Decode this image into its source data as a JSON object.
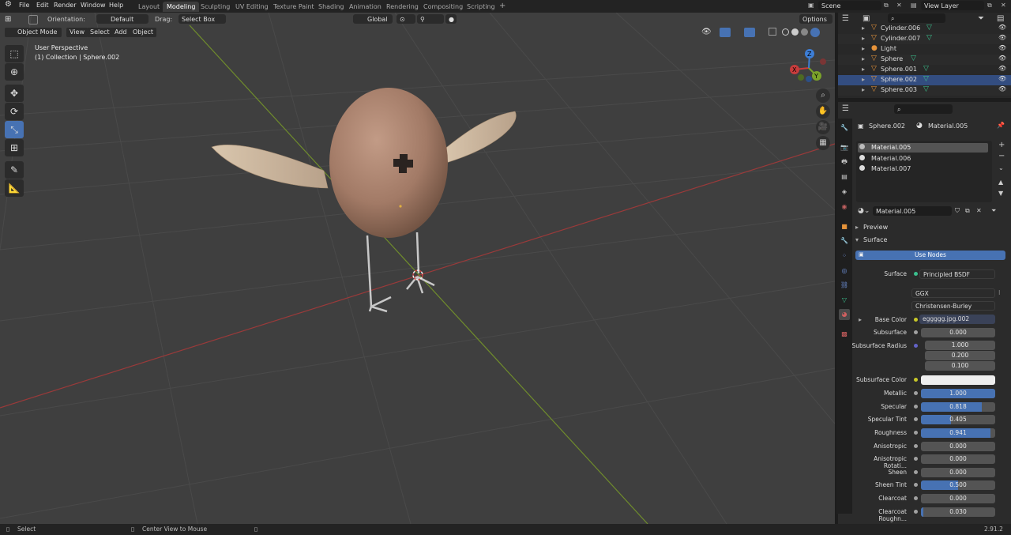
{
  "menubar": {
    "items": [
      "File",
      "Edit",
      "Render",
      "Window",
      "Help"
    ]
  },
  "workspaces": {
    "tabs": [
      "Layout",
      "Modeling",
      "Sculpting",
      "UV Editing",
      "Texture Paint",
      "Shading",
      "Animation",
      "Rendering",
      "Compositing",
      "Scripting"
    ],
    "active": "Modeling",
    "add": "+"
  },
  "scene": {
    "label": "Scene",
    "view_layer": "View Layer"
  },
  "tool_settings": {
    "orientation_label": "Orientation:",
    "orientation_value": "Default",
    "drag_label": "Drag:",
    "drag_value": "Select Box",
    "transform_orientation": "Global",
    "options": "Options"
  },
  "viewport_header": {
    "mode": "Object Mode",
    "view": "View",
    "select": "Select",
    "add": "Add",
    "object": "Object"
  },
  "viewport": {
    "perspective": "User Perspective",
    "collection": "(1) Collection | Sphere.002"
  },
  "gizmo": {
    "x": "X",
    "y": "Y",
    "z": "Z"
  },
  "outliner": {
    "search_placeholder": "",
    "rows": [
      {
        "name": "Cylinder.006",
        "type": "mesh"
      },
      {
        "name": "Cylinder.007",
        "type": "mesh"
      },
      {
        "name": "Light",
        "type": "light"
      },
      {
        "name": "Sphere",
        "type": "mesh"
      },
      {
        "name": "Sphere.001",
        "type": "mesh"
      },
      {
        "name": "Sphere.002",
        "type": "mesh",
        "selected": true
      },
      {
        "name": "Sphere.003",
        "type": "mesh"
      }
    ]
  },
  "properties": {
    "object": "Sphere.002",
    "material": "Material.005",
    "slots": [
      "Material.005",
      "Material.006",
      "Material.007"
    ],
    "material_field": "Material.005",
    "preview": "Preview",
    "surface_section": "Surface",
    "use_nodes": "Use Nodes",
    "surface_label": "Surface",
    "surface_value": "Principled BSDF",
    "distribution": "GGX",
    "subsurface_method": "Christensen-Burley",
    "base_color_label": "Base Color",
    "base_color_value": "eggggg.jpg.002",
    "subsurface_radius_label": "Subsurface Radius",
    "subsurface_radius": [
      "1.000",
      "0.200",
      "0.100"
    ],
    "subsurface_color_label": "Subsurface Color",
    "sliders": [
      {
        "label": "Subsurface",
        "value": "0.000",
        "fill": 0
      },
      {
        "label": "Metallic",
        "value": "1.000",
        "fill": 1.0
      },
      {
        "label": "Specular",
        "value": "0.818",
        "fill": 0.818
      },
      {
        "label": "Specular Tint",
        "value": "0.405",
        "fill": 0.405
      },
      {
        "label": "Roughness",
        "value": "0.941",
        "fill": 0.941
      },
      {
        "label": "Anisotropic",
        "value": "0.000",
        "fill": 0
      },
      {
        "label": "Anisotropic Rotati...",
        "value": "0.000",
        "fill": 0
      },
      {
        "label": "Sheen",
        "value": "0.000",
        "fill": 0
      },
      {
        "label": "Sheen Tint",
        "value": "0.500",
        "fill": 0.5
      },
      {
        "label": "Clearcoat",
        "value": "0.000",
        "fill": 0
      },
      {
        "label": "Clearcoat Roughn...",
        "value": "0.030",
        "fill": 0.03
      }
    ]
  },
  "statusbar": {
    "left": "Select",
    "middle": "Center View to Mouse",
    "version": "2.91.2"
  },
  "colors": {
    "accent": "#4772b3",
    "background": "#3f3f3f",
    "panel": "#2b2b2b",
    "x_axis": "#c83c3c",
    "y_axis": "#7ba32a",
    "z_axis": "#3d7ed6"
  }
}
